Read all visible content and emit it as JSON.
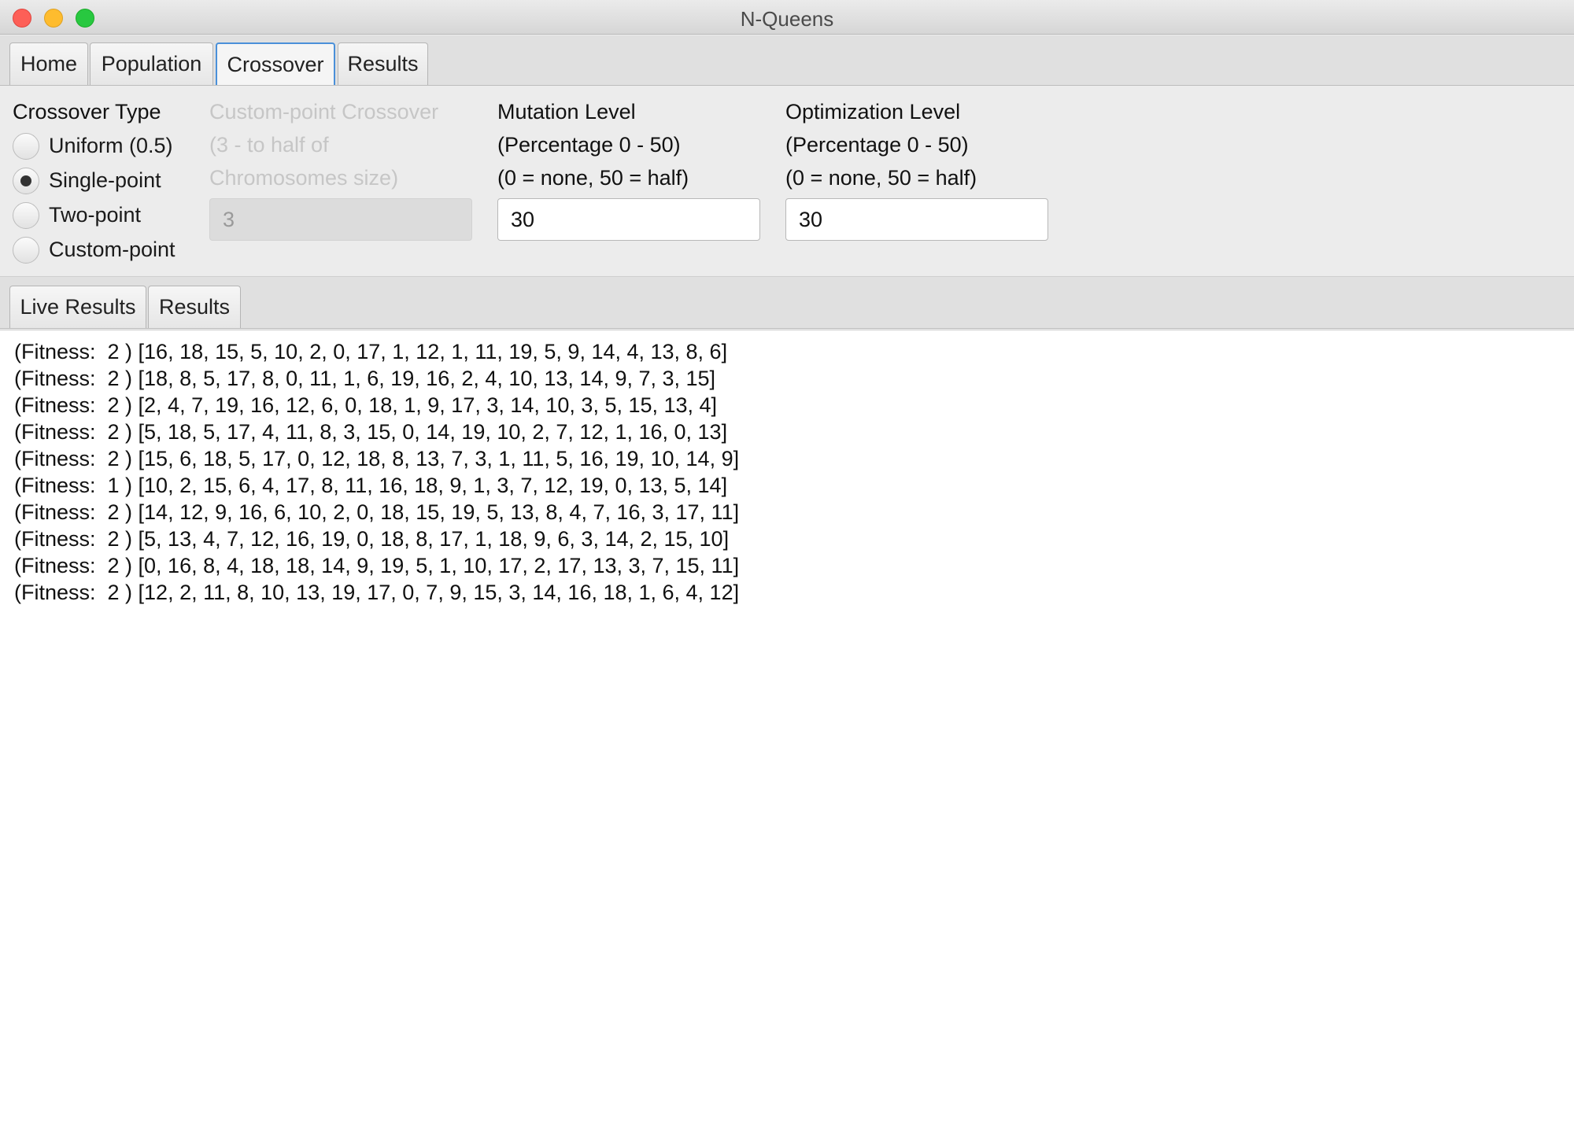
{
  "window": {
    "title": "N-Queens"
  },
  "main_tabs": [
    {
      "label": "Home"
    },
    {
      "label": "Population"
    },
    {
      "label": "Crossover",
      "active": true
    },
    {
      "label": "Results"
    }
  ],
  "crossover": {
    "type_label": "Crossover Type",
    "options": [
      {
        "label": "Uniform (0.5)",
        "selected": false
      },
      {
        "label": "Single-point",
        "selected": true
      },
      {
        "label": "Two-point",
        "selected": false
      },
      {
        "label": "Custom-point",
        "selected": false
      }
    ],
    "custom_point": {
      "title": "Custom-point Crossover",
      "hint1": "(3 - to half of",
      "hint2": "Chromosomes size)",
      "value": "3",
      "enabled": false
    }
  },
  "mutation": {
    "title": "Mutation Level",
    "hint1": "(Percentage 0 - 50)",
    "hint2": "(0 = none, 50 = half)",
    "value": "30"
  },
  "optimization": {
    "title": "Optimization Level",
    "hint1": "(Percentage 0 - 50)",
    "hint2": "(0 = none, 50 = half)",
    "value": "30"
  },
  "results_tabs": [
    {
      "label": "Live Results",
      "active": true
    },
    {
      "label": "Results"
    }
  ],
  "live_results": [
    "(Fitness:  2 ) [16, 18, 15, 5, 10, 2, 0, 17, 1, 12, 1, 11, 19, 5, 9, 14, 4, 13, 8, 6]",
    "(Fitness:  2 ) [18, 8, 5, 17, 8, 0, 11, 1, 6, 19, 16, 2, 4, 10, 13, 14, 9, 7, 3, 15]",
    "(Fitness:  2 ) [2, 4, 7, 19, 16, 12, 6, 0, 18, 1, 9, 17, 3, 14, 10, 3, 5, 15, 13, 4]",
    "(Fitness:  2 ) [5, 18, 5, 17, 4, 11, 8, 3, 15, 0, 14, 19, 10, 2, 7, 12, 1, 16, 0, 13]",
    "(Fitness:  2 ) [15, 6, 18, 5, 17, 0, 12, 18, 8, 13, 7, 3, 1, 11, 5, 16, 19, 10, 14, 9]",
    "(Fitness:  1 ) [10, 2, 15, 6, 4, 17, 8, 11, 16, 18, 9, 1, 3, 7, 12, 19, 0, 13, 5, 14]",
    "(Fitness:  2 ) [14, 12, 9, 16, 6, 10, 2, 0, 18, 15, 19, 5, 13, 8, 4, 7, 16, 3, 17, 11]",
    "(Fitness:  2 ) [5, 13, 4, 7, 12, 16, 19, 0, 18, 8, 17, 1, 18, 9, 6, 3, 14, 2, 15, 10]",
    "(Fitness:  2 ) [0, 16, 8, 4, 18, 18, 14, 9, 19, 5, 1, 10, 17, 2, 17, 13, 3, 7, 15, 11]",
    "(Fitness:  2 ) [12, 2, 11, 8, 10, 13, 19, 17, 0, 7, 9, 15, 3, 14, 16, 18, 1, 6, 4, 12]"
  ]
}
